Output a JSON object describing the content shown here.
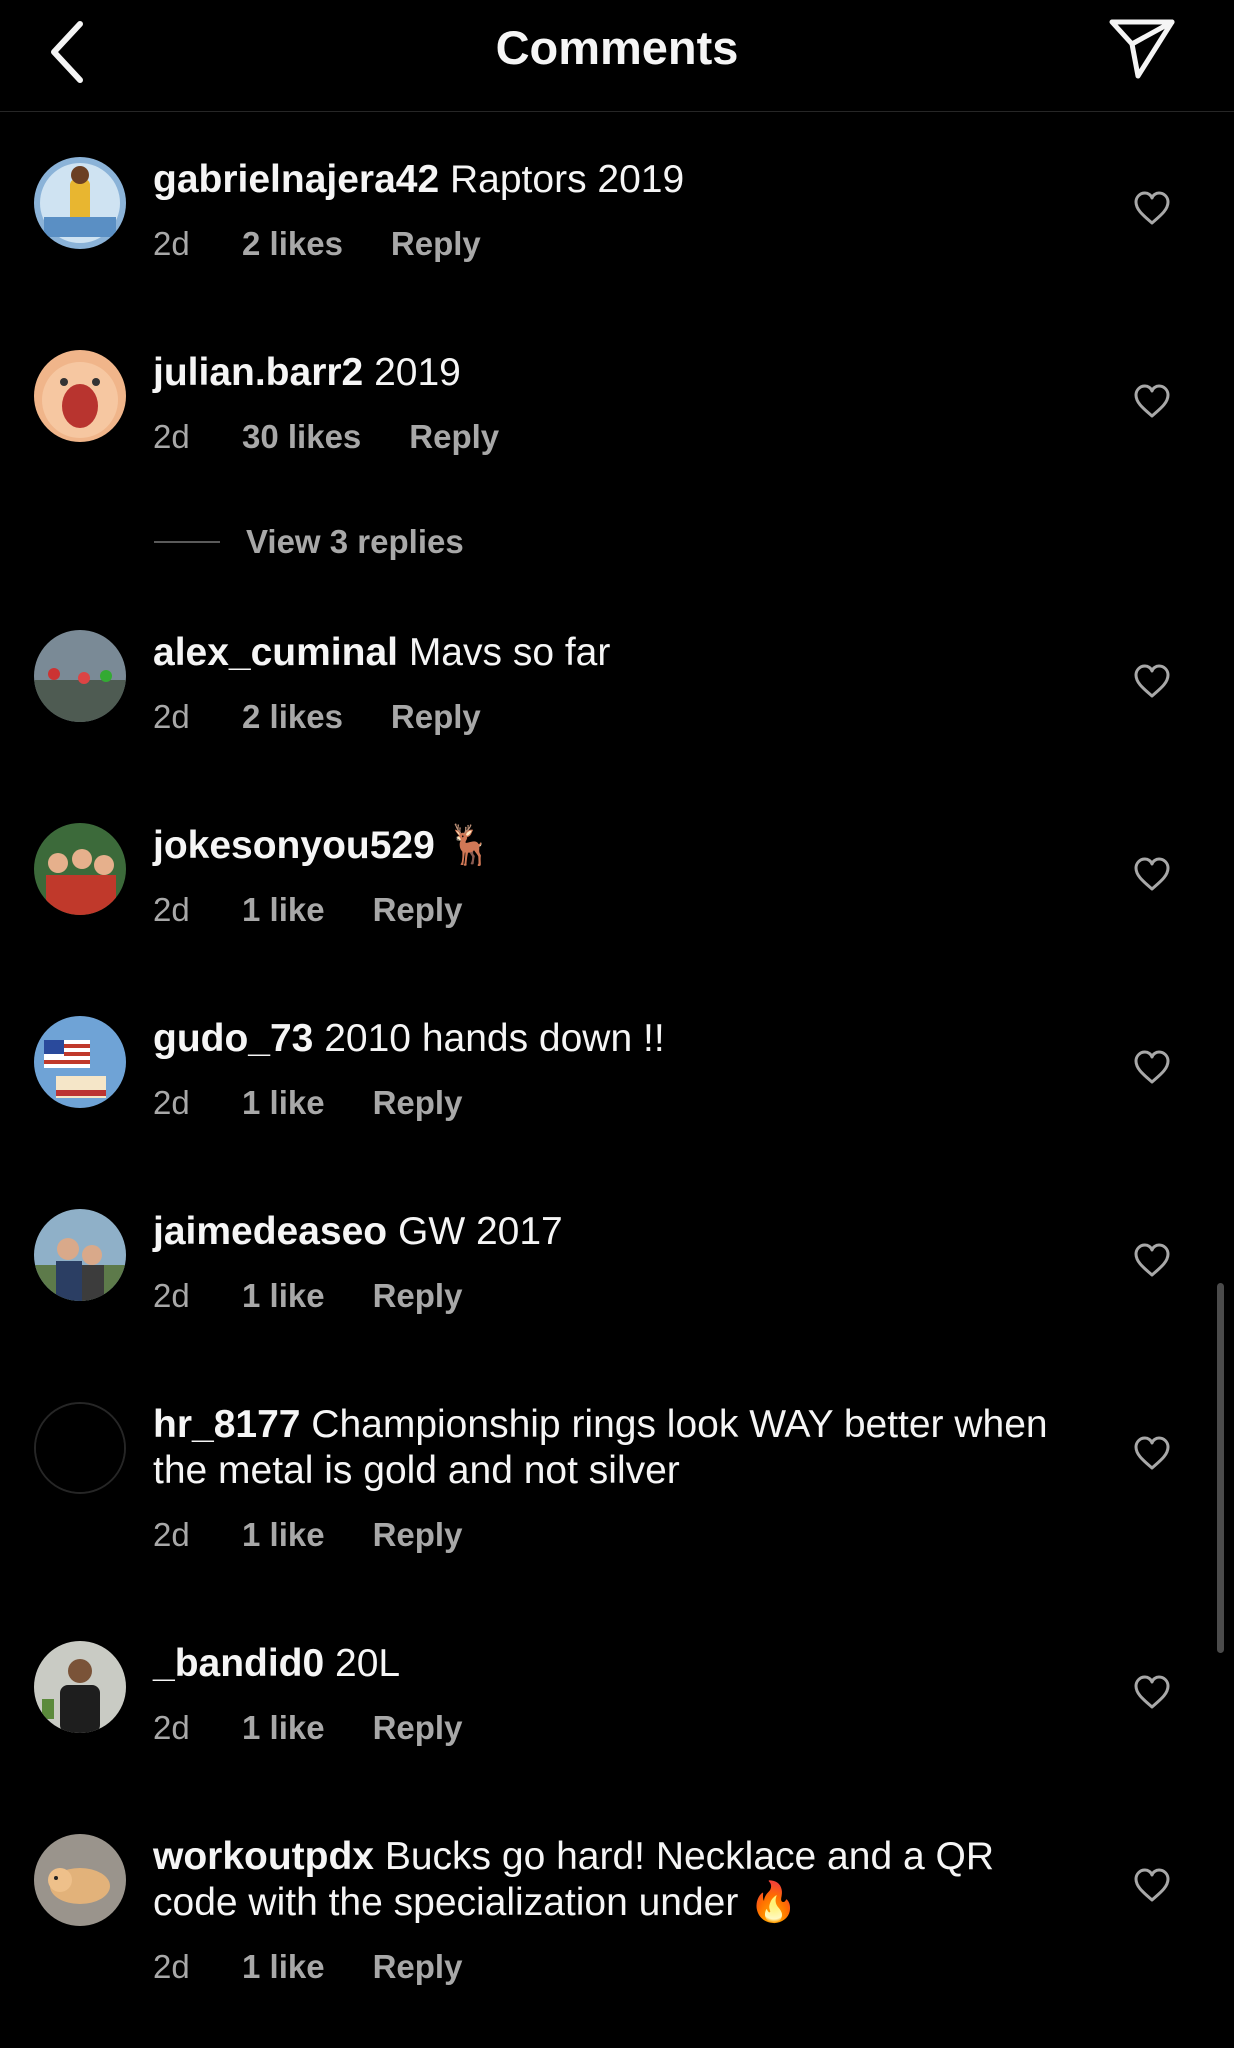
{
  "header": {
    "title": "Comments",
    "back_icon": "chevron-left-icon",
    "share_icon": "paper-plane-icon"
  },
  "comments": [
    {
      "username": "gabrielnajera42",
      "text": "Raptors 2019",
      "time": "2d",
      "likes": "2 likes",
      "reply": "Reply"
    },
    {
      "username": "julian.barr2",
      "text": "2019",
      "time": "2d",
      "likes": "30 likes",
      "reply": "Reply"
    },
    {
      "username": "alex_cuminal",
      "text": "Mavs so far",
      "time": "2d",
      "likes": "2 likes",
      "reply": "Reply"
    },
    {
      "username": "jokesonyou529",
      "text": "🦌",
      "time": "2d",
      "likes": "1 like",
      "reply": "Reply"
    },
    {
      "username": "gudo_73",
      "text": "2010 hands down !!",
      "time": "2d",
      "likes": "1 like",
      "reply": "Reply"
    },
    {
      "username": "jaimedeaseo",
      "text": "GW 2017",
      "time": "2d",
      "likes": "1 like",
      "reply": "Reply"
    },
    {
      "username": "hr_8177",
      "text": "Championship rings look WAY better when the metal is gold and not silver",
      "time": "2d",
      "likes": "1 like",
      "reply": "Reply"
    },
    {
      "username": "_bandid0",
      "text": "20L",
      "time": "2d",
      "likes": "1 like",
      "reply": "Reply"
    },
    {
      "username": "workoutpdx",
      "text": "Bucks go hard!  Necklace and a QR code with the specialization under 🔥",
      "time": "2d",
      "likes": "1 like",
      "reply": "Reply"
    }
  ],
  "view_replies": "View 3 replies",
  "colors": {
    "background": "#000000",
    "text_primary": "#f5f5f5",
    "text_secondary": "#a8a8a8",
    "divider": "#262626"
  }
}
